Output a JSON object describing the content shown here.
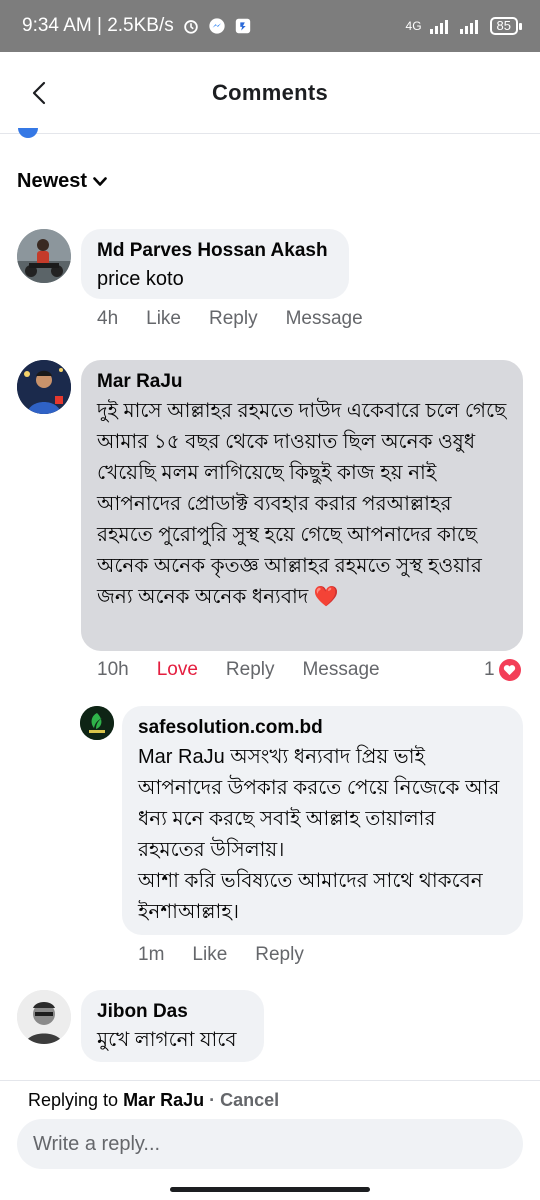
{
  "status_bar": {
    "time_speed": "9:34 AM | 2.5KB/s",
    "network": "4G",
    "battery": "85"
  },
  "header": {
    "title": "Comments"
  },
  "sort": {
    "label": "Newest"
  },
  "comments": [
    {
      "author": "Md Parves Hossan Akash",
      "text": "price koto",
      "time": "4h",
      "like": "Like",
      "reply": "Reply",
      "message": "Message"
    },
    {
      "author": "Mar RaJu",
      "text": "দুই মাসে আল্লাহর রহমতে দাউদ একেবারে চলে গেছে আমার ১৫ বছর থেকে দাওয়াত ছিল অনেক ওষুধ খেয়েছি মলম লাগিয়েছে কিছুই কাজ হয় নাই আপনাদের প্রোডাক্ট ব্যবহার করার পরআল্লাহর রহমতে পুরোপুরি সুস্থ হয়ে গেছে আপনাদের কাছে অনেক অনেক কৃতজ্ঞ আল্লাহর রহমতে সুস্থ হওয়ার জন্য অনেক অনেক ধন্যবাদ ❤️",
      "time": "10h",
      "like": "Love",
      "reply": "Reply",
      "message": "Message",
      "reaction_count": "1"
    },
    {
      "author": "safesolution.com.bd",
      "text": "Mar RaJu অসংখ্য ধন্যবাদ প্রিয় ভাই আপনাদের উপকার করতে পেয়ে নিজেকে আর ধন্য মনে করছে সবাই আল্লাহ তায়ালার রহমতের উসিলায়।\nআশা করি ভবিষ্যতে আমাদের সাথে থাকবেন ইনশাআল্লাহ।",
      "time": "1m",
      "like": "Like",
      "reply": "Reply"
    },
    {
      "author": "Jibon Das",
      "text": "মুখে লাগনো যাবে"
    }
  ],
  "reply_bar": {
    "replying_prefix": "Replying to ",
    "replying_to": "Mar RaJu",
    "cancel": " · Cancel",
    "placeholder": "Write a reply..."
  },
  "colors": {
    "accent": "#3578e5",
    "love": "#e41e3f",
    "bubble": "#f0f2f5",
    "bubble_highlight": "#d8d9dd",
    "status_bar": "#7d7d7d"
  }
}
